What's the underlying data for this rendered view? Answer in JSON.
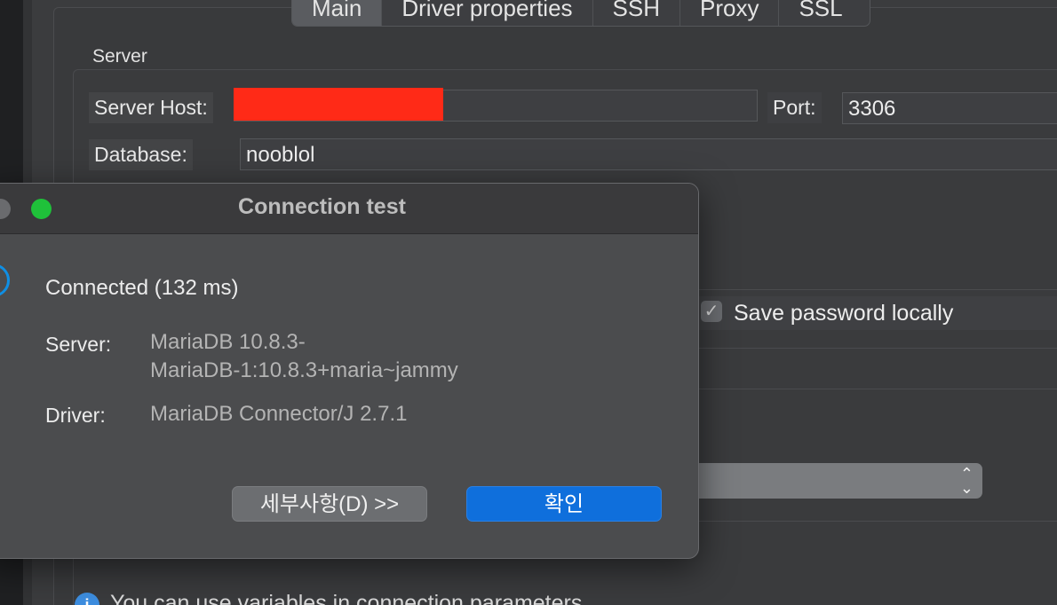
{
  "tabs": [
    {
      "label": "Main",
      "active": true
    },
    {
      "label": "Driver properties",
      "active": false
    },
    {
      "label": "SSH",
      "active": false
    },
    {
      "label": "Proxy",
      "active": false
    },
    {
      "label": "SSL",
      "active": false
    }
  ],
  "server_group": {
    "title": "Server",
    "host_label": "Server Host:",
    "host_value": "",
    "port_label": "Port:",
    "port_value": "3306",
    "database_label": "Database:",
    "database_value": "nooblol"
  },
  "auth": {
    "save_password_label": "Save password locally",
    "save_password_checked": true,
    "checkmark": "✓"
  },
  "select": {
    "arrows_up": "⌃",
    "arrows_down": "⌄"
  },
  "footer": {
    "info_icon": "i",
    "info_text": "You can use variables in connection parameters"
  },
  "dialog": {
    "title": "Connection test",
    "status": "Connected (132 ms)",
    "server_label": "Server:",
    "server_value_line1": "MariaDB 10.8.3-",
    "server_value_line2": "MariaDB-1:10.8.3+maria~jammy",
    "driver_label": "Driver:",
    "driver_value": "MariaDB Connector/J 2.7.1",
    "details_button": "세부사항(D) >>",
    "ok_button": "확인"
  },
  "colors": {
    "accent_blue": "#0f6fdc",
    "status_ring": "#0f8fe4",
    "redaction": "#ff2a17",
    "traffic_green": "#1fc13a"
  }
}
